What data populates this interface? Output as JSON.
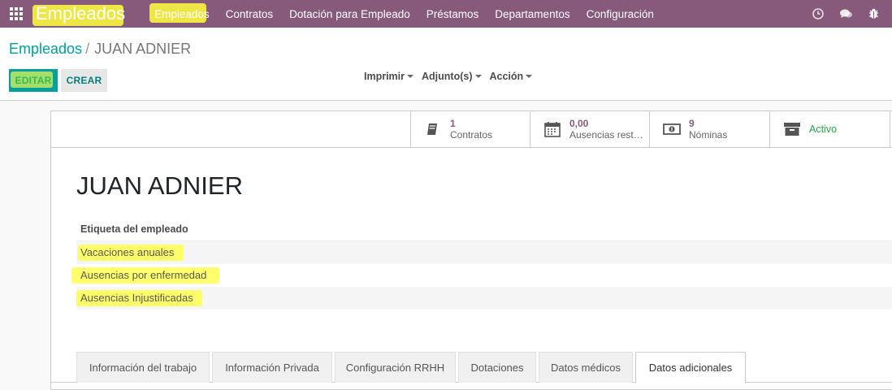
{
  "navbar": {
    "brand": "Empleados",
    "menu": [
      "Empleados",
      "Contratos",
      "Dotación para Empleado",
      "Préstamos",
      "Departamentos",
      "Configuración"
    ],
    "icons": [
      "activity-clock-icon",
      "discuss-chat-icon",
      "debug-bug-icon"
    ],
    "color": "#875a7b"
  },
  "breadcrumb": {
    "parent": "Empleados",
    "separator": "/",
    "current": "JUAN ADNIER"
  },
  "buttons": {
    "edit": "EDITAR",
    "create": "CREAR"
  },
  "sidebar_menus": [
    "Imprimir",
    "Adjunto(s)",
    "Acción"
  ],
  "smart_buttons": {
    "contratos": {
      "value": "1",
      "label": "Contratos",
      "icon": "book-icon"
    },
    "ausencias": {
      "value": "0,00",
      "label": "Ausencias rest…",
      "icon": "calendar-icon"
    },
    "nominas": {
      "value": "9",
      "label": "Nóminas",
      "icon": "money-icon"
    },
    "activo": {
      "label": "Activo",
      "icon": "archive-icon"
    }
  },
  "employee": {
    "name": "JUAN ADNIER",
    "tags_header": "Etiqueta del empleado",
    "tags": [
      "Vacaciones anuales",
      "Ausencias por enfermedad",
      "Ausencias Injustificadas"
    ]
  },
  "tabs": [
    "Información del trabajo",
    "Información Privada",
    "Configuración RRHH",
    "Dotaciones",
    "Datos médicos",
    "Datos adicionales"
  ],
  "active_tab": "Datos adicionales",
  "colors": {
    "accent": "#00a09d",
    "highlight": "#ffff46",
    "active_status": "#28a745"
  }
}
